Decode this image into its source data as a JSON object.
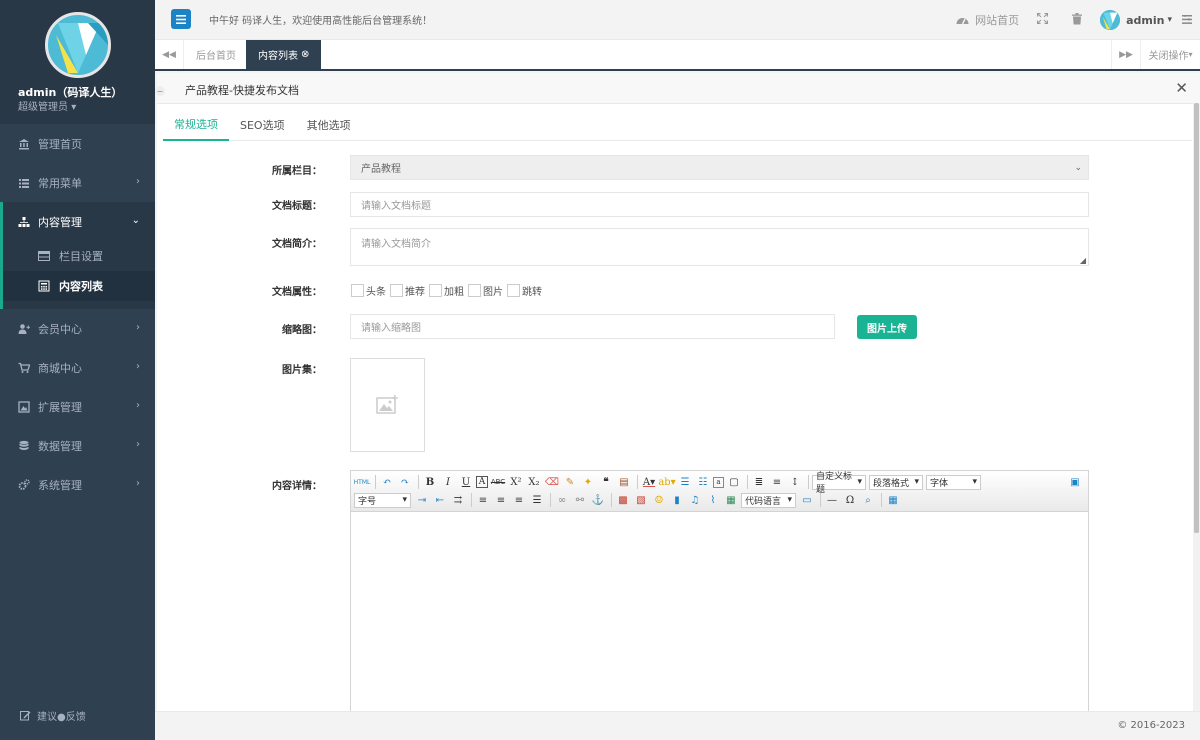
{
  "sidebar": {
    "user_name": "admin（码译人生）",
    "user_role": "超级管理员",
    "items": [
      {
        "label": "管理首页"
      },
      {
        "label": "常用菜单"
      },
      {
        "label": "内容管理"
      },
      {
        "label": "会员中心"
      },
      {
        "label": "商城中心"
      },
      {
        "label": "扩展管理"
      },
      {
        "label": "数据管理"
      },
      {
        "label": "系统管理"
      }
    ],
    "subitems": [
      {
        "label": "栏目设置"
      },
      {
        "label": "内容列表"
      }
    ],
    "feedback": "建议●反馈"
  },
  "topbar": {
    "welcome": "中午好 码译人生，欢迎使用高性能后台管理系统！",
    "site_home": "网站首页",
    "admin": "admin"
  },
  "tabs": {
    "home": "后台首页",
    "active": "内容列表",
    "close_ops": "关闭操作"
  },
  "window": {
    "title": "产品教程-快捷发布文档"
  },
  "subtabs": [
    "常规选项",
    "SEO选项",
    "其他选项"
  ],
  "form": {
    "category_label": "所属栏目：",
    "category_value": "产品教程",
    "title_label": "文档标题：",
    "title_placeholder": "请输入文档标题",
    "summary_label": "文档简介：",
    "summary_placeholder": "请输入文档简介",
    "attr_label": "文档属性：",
    "attrs": [
      "头条",
      "推荐",
      "加粗",
      "图片",
      "跳转"
    ],
    "thumb_label": "缩略图：",
    "thumb_placeholder": "请输入缩略图",
    "upload_button": "图片上传",
    "gallery_label": "图片集：",
    "content_label": "内容详情："
  },
  "editor": {
    "combos_row1": [
      "自定义标题",
      "段落格式",
      "字体"
    ],
    "combos_row2": [
      "字号",
      "代码语言"
    ]
  },
  "footer": {
    "copyright": "© 2016-2023"
  }
}
